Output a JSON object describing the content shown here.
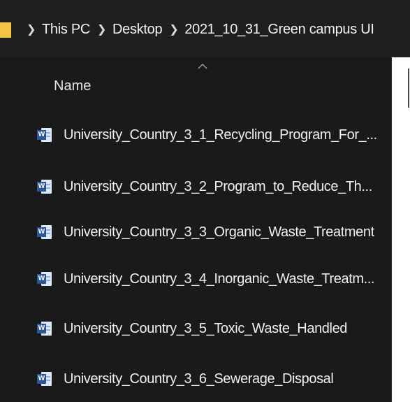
{
  "breadcrumb": {
    "items": [
      "This PC",
      "Desktop",
      "2021_10_31_Green campus UI"
    ]
  },
  "columns": {
    "name_label": "Name"
  },
  "files": [
    {
      "name": "University_Country_3_1_Recycling_Program_For_...",
      "icon": "word-doc-icon"
    },
    {
      "name": "University_Country_3_2_Program_to_Reduce_Th...",
      "icon": "word-doc-icon"
    },
    {
      "name": "University_Country_3_3_Organic_Waste_Treatment",
      "icon": "word-doc-icon"
    },
    {
      "name": "University_Country_3_4_Inorganic_Waste_Treatm...",
      "icon": "word-doc-icon"
    },
    {
      "name": "University_Country_3_5_Toxic_Waste_Handled",
      "icon": "word-doc-icon"
    },
    {
      "name": "University_Country_3_6_Sewerage_Disposal",
      "icon": "word-doc-icon"
    }
  ],
  "icons": {
    "word_badge_letter": "W"
  },
  "colors": {
    "background": "#1a1a1a",
    "text": "#f0f0f0",
    "folder": "#f4c443",
    "word_blue": "#2b579a"
  }
}
